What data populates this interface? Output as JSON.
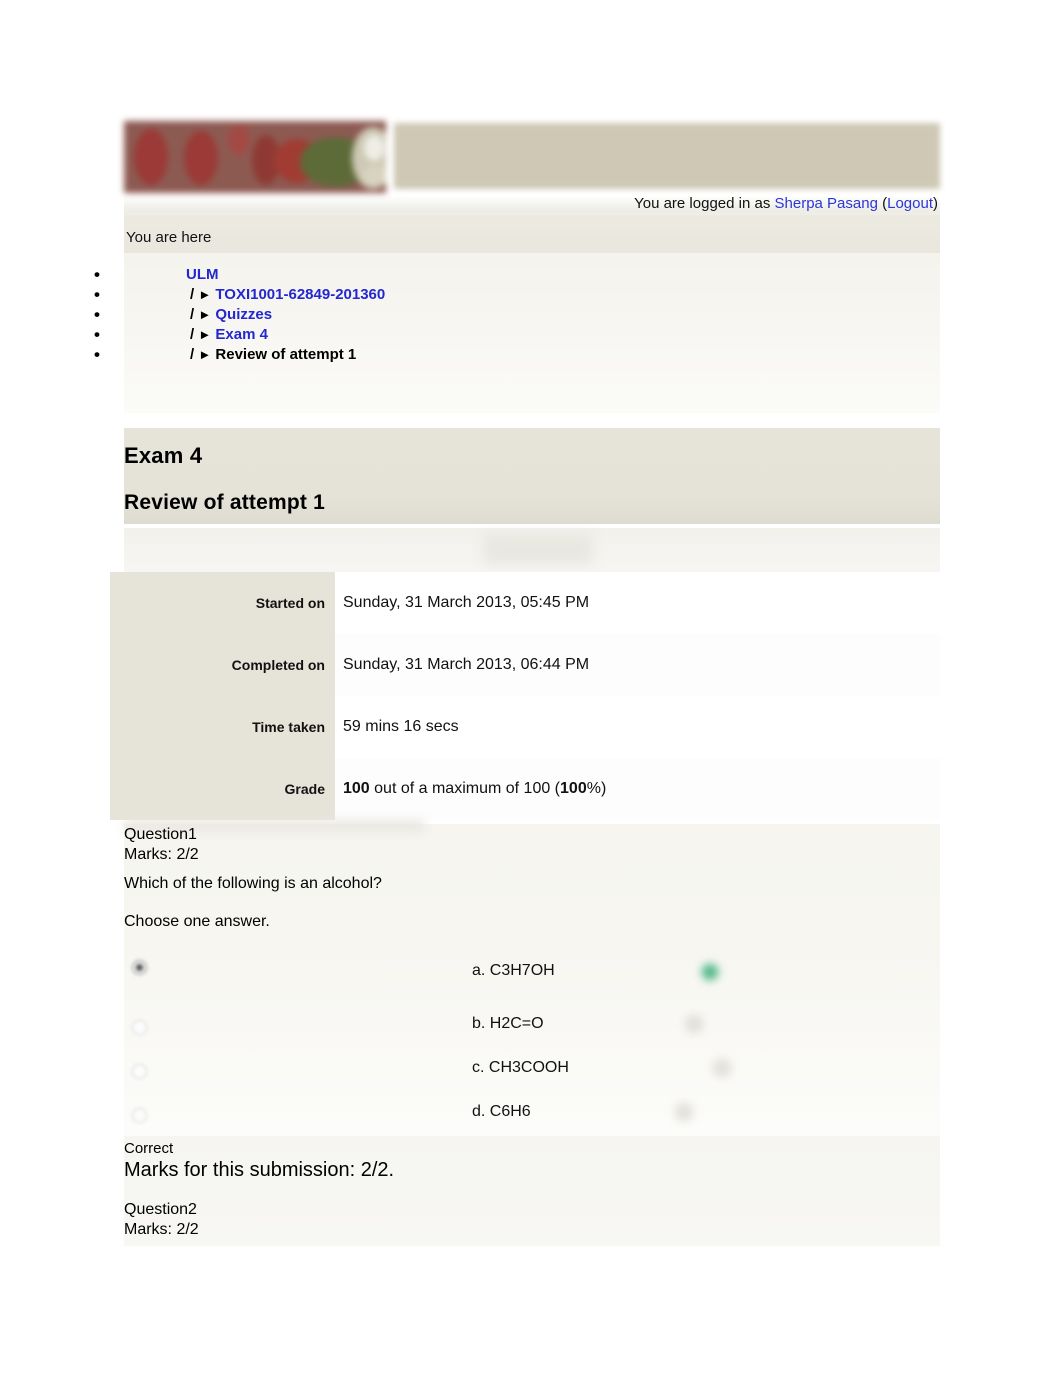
{
  "header": {
    "logo_alt": "ULM banner logo",
    "login_prefix": "You are logged in as",
    "user_name": "Sherpa Pasang",
    "paren_open": "(",
    "logout_label": "Logout",
    "paren_close": ")",
    "accent_link_color": "#2b35d8"
  },
  "navigation": {
    "you_are_here": "You are here",
    "breadcrumb": [
      {
        "sep": "",
        "arrow": "",
        "label": "ULM",
        "link": true
      },
      {
        "sep": "/",
        "arrow": "►",
        "label": "TOXI1001-62849-201360",
        "link": true
      },
      {
        "sep": "/",
        "arrow": "►",
        "label": "Quizzes",
        "link": true
      },
      {
        "sep": "/",
        "arrow": "►",
        "label": "Exam 4",
        "link": true
      },
      {
        "sep": "/",
        "arrow": "►",
        "label": "Review of attempt 1",
        "link": false
      }
    ],
    "link_color": "#2327cf"
  },
  "page": {
    "title": "Exam 4",
    "subtitle": "Review of attempt 1"
  },
  "attempt_info": {
    "rows": [
      {
        "label": "Started on",
        "value": "Sunday, 31 March 2013, 05:45 PM"
      },
      {
        "label": "Completed on",
        "value": "Sunday, 31 March 2013, 06:44 PM"
      },
      {
        "label": "Time taken",
        "value": "59 mins 16 secs"
      }
    ],
    "grade_label": "Grade",
    "grade_score": "100",
    "grade_middle": " out of a maximum of 100 (",
    "grade_percent": "100",
    "grade_tail": "%)"
  },
  "question1": {
    "number": "Question1",
    "marks": "Marks: 2/2",
    "text": "Which of the following is an alcohol?",
    "instruction": "Choose one answer.",
    "options": [
      {
        "label": "a. C3H7OH",
        "selected": true,
        "mark": "correct-icon"
      },
      {
        "label": "b. H2C=O",
        "selected": false,
        "mark": "blank-icon"
      },
      {
        "label": "c. CH3COOH",
        "selected": false,
        "mark": "blank-icon"
      },
      {
        "label": "d. C6H6",
        "selected": false,
        "mark": "blank-icon"
      }
    ],
    "feedback_status": "Correct",
    "feedback_marks": "Marks for this submission: 2/2."
  },
  "question2": {
    "number": "Question2",
    "marks": "Marks: 2/2"
  }
}
